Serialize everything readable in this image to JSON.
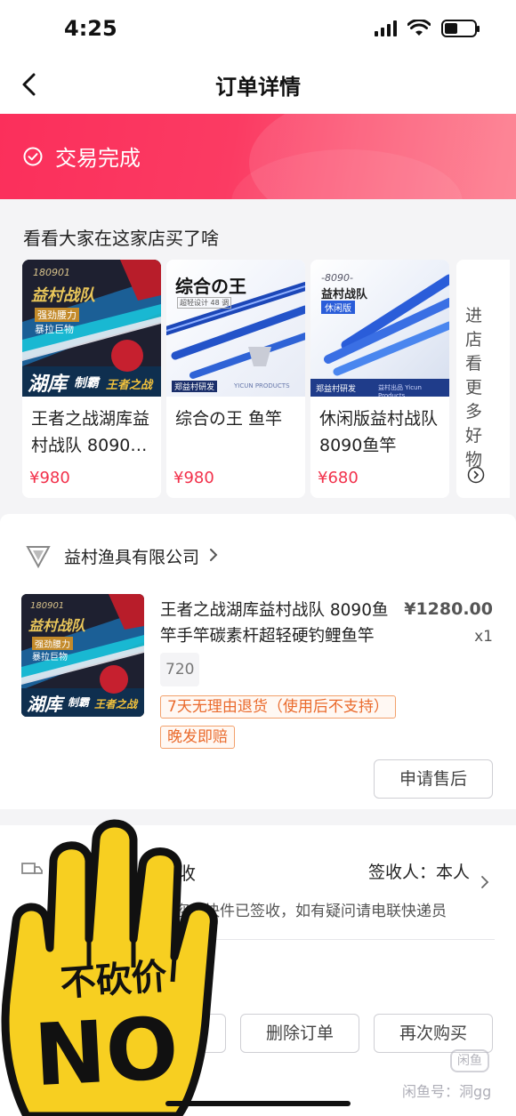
{
  "status_bar": {
    "time": "4:25"
  },
  "nav": {
    "title": "订单详情"
  },
  "banner": {
    "status": "交易完成",
    "color": "#fb2f5b"
  },
  "recommend": {
    "title": "看看大家在这家店买了啥",
    "items": [
      {
        "name": "王者之战湖库益村战队 8090鱼竿",
        "price": "¥980",
        "thumb_text": [
          "180901",
          "益村战队",
          "强劲腰力",
          "暴拉巨物",
          "湖库",
          "制霸",
          "王者之战"
        ]
      },
      {
        "name": "综合の王 鱼竿",
        "price": "¥980",
        "thumb_text": [
          "综合の王",
          "超轻设计 48 调",
          "郑益村研发",
          "YICUN PRODUCTS"
        ]
      },
      {
        "name": "休闲版益村战队 8090鱼竿",
        "price": "¥680",
        "thumb_text": [
          "-8090-",
          "益村战队",
          "休闲版",
          "郑益村研发",
          "益村出品 Yicun Products"
        ]
      }
    ],
    "more_label": "进店看更多好物"
  },
  "store": {
    "name": "益村渔具有限公司"
  },
  "order": {
    "name": "王者之战湖库益村战队 8090鱼竿手竿碳素杆超轻硬钓鲤鱼竿",
    "price": "¥1280.00",
    "quantity": "x1",
    "spec": "720",
    "tags": [
      "7天无理由退货（使用后不支持）",
      "晚发即赔"
    ],
    "after_sale_button": "申请售后"
  },
  "logistics": {
    "status": "收",
    "receiver": "签收人：本人",
    "detail": "您的快件已签收，如有疑问请电联快递员"
  },
  "actions": {
    "delete_order": "删除订单",
    "buy_again": "再次购买"
  },
  "sticker": {
    "line1": "不砍价",
    "line2": "NO"
  },
  "watermark": {
    "text": "闲鱼号：洞gg",
    "icon_text": "闲鱼"
  },
  "colors": {
    "price_red": "#f2314b",
    "tag_orange": "#ea6a2c"
  }
}
